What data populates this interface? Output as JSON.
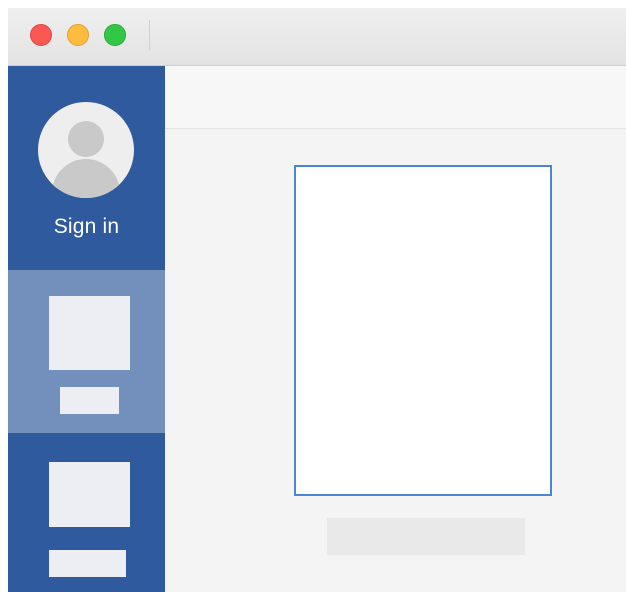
{
  "window": {
    "controls": [
      {
        "name": "close",
        "color": "#fc5753"
      },
      {
        "name": "minimize",
        "color": "#fdbc40"
      },
      {
        "name": "zoom",
        "color": "#33c748"
      }
    ]
  },
  "sidebar": {
    "account": {
      "avatar_icon": "default-user-avatar",
      "label": "Sign in"
    },
    "items": [
      {
        "selected": true,
        "thumbnail": "blank-thumbnail",
        "caption": ""
      },
      {
        "selected": false,
        "thumbnail": "blank-thumbnail",
        "caption": ""
      }
    ]
  },
  "main": {
    "document": {
      "selected": true,
      "caption": ""
    }
  },
  "colors": {
    "sidebar": "#2c5699",
    "selected_sidebar_item": "#7390bc",
    "document_selection": "#4a86d6",
    "placeholder": "#eceef3"
  }
}
